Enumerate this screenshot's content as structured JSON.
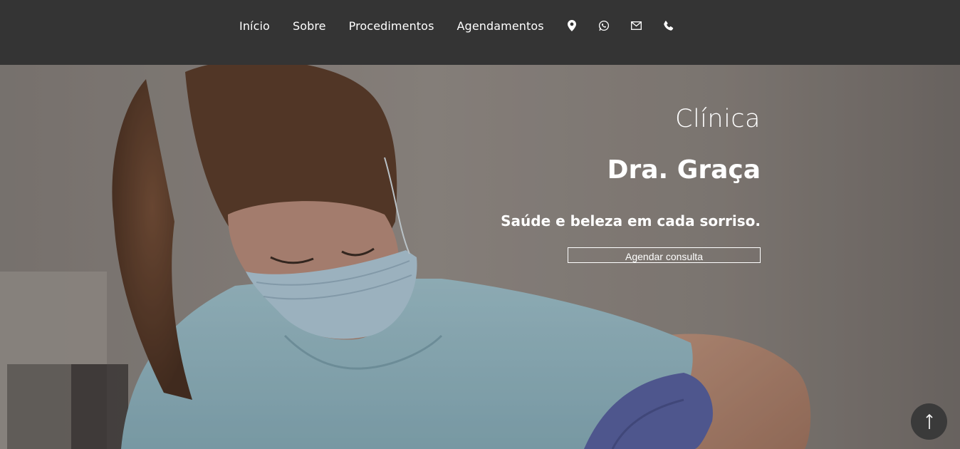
{
  "nav": {
    "links": [
      {
        "label": "Início"
      },
      {
        "label": "Sobre"
      },
      {
        "label": "Procedimentos"
      },
      {
        "label": "Agendamentos"
      }
    ],
    "icons": [
      "location-pin-icon",
      "whatsapp-icon",
      "mail-icon",
      "phone-icon"
    ]
  },
  "hero": {
    "pretitle": "Clínica",
    "title": "Dra. Graça",
    "subtitle": "Saúde e beleza em cada sorriso.",
    "cta_label": "Agendar consulta"
  },
  "scroll_top": {
    "icon": "arrow-up-icon"
  },
  "colors": {
    "navbar_bg": "#343434",
    "text": "#ffffff",
    "scrub_blue": "#9ec5d1",
    "glove_blue": "#5b64a8"
  }
}
